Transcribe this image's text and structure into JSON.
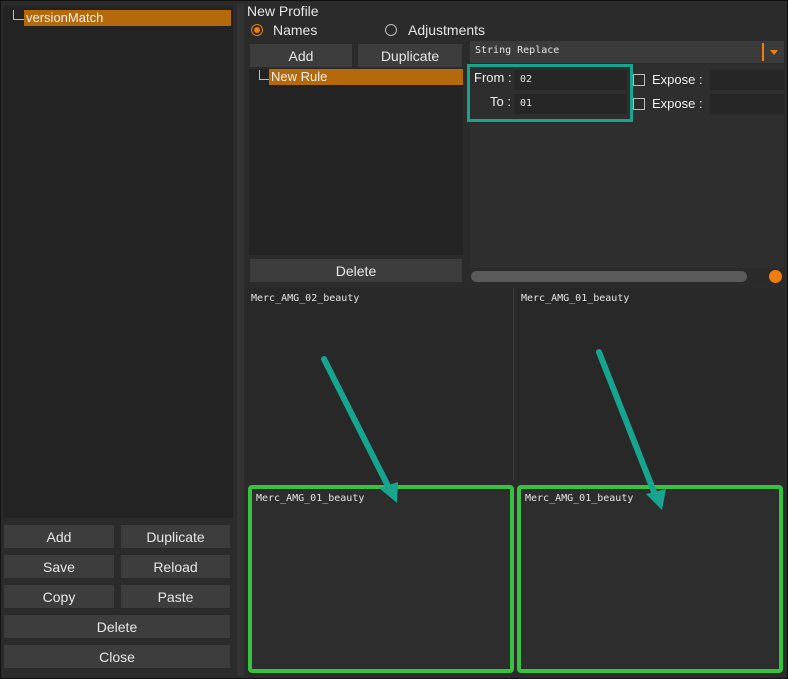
{
  "left_panel": {
    "tree_item": "versionMatch",
    "buttons": {
      "add": "Add",
      "duplicate": "Duplicate",
      "save": "Save",
      "reload": "Reload",
      "copy": "Copy",
      "paste": "Paste",
      "delete": "Delete",
      "close": "Close"
    }
  },
  "profile": {
    "title": "New Profile",
    "tabs": {
      "names": "Names",
      "adjustments": "Adjustments",
      "selected": "Names"
    }
  },
  "rules": {
    "add": "Add",
    "duplicate": "Duplicate",
    "items": [
      "New Rule"
    ],
    "delete": "Delete"
  },
  "operation": {
    "selected": "String Replace",
    "from_label": "From :",
    "from_value": "02",
    "to_label": "To :",
    "to_value": "01",
    "expose_label": "Expose :"
  },
  "previews": {
    "top_left": "Merc_AMG_02_beauty",
    "top_right": "Merc_AMG_01_beauty",
    "bottom_left": "Merc_AMG_01_beauty",
    "bottom_right": "Merc_AMG_01_beauty"
  },
  "colors": {
    "accent_orange": "#f07d10",
    "selection": "#b46a0a",
    "highlight_teal": "#17a58f",
    "highlight_green": "#37c23f"
  }
}
